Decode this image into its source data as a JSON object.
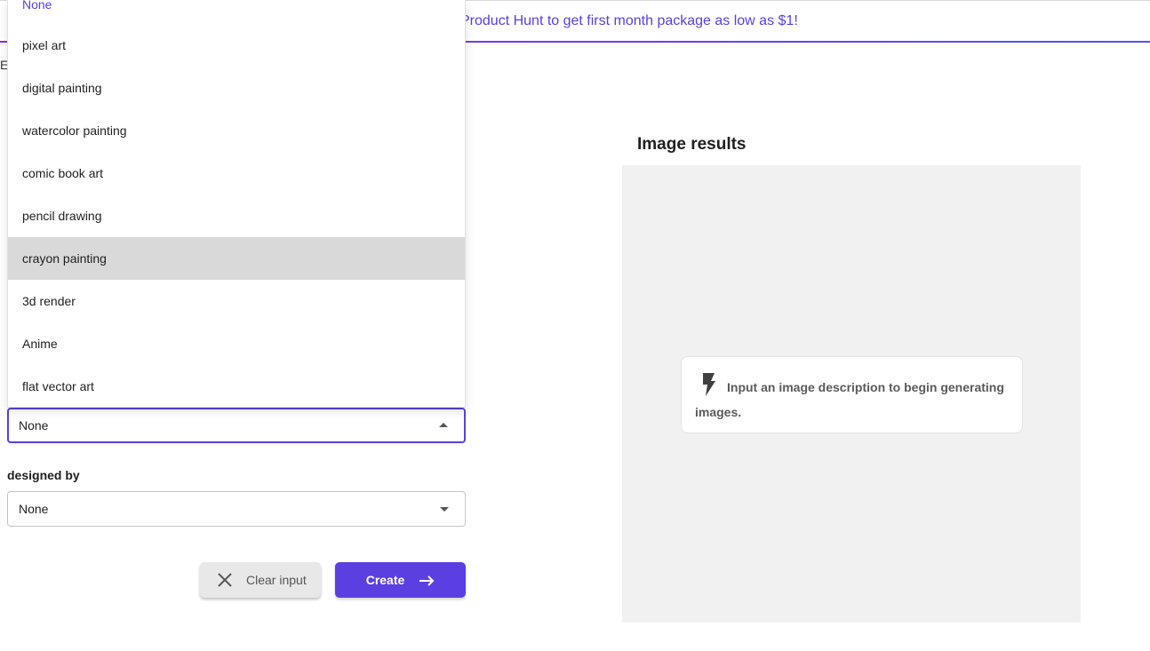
{
  "banner": {
    "text": "Product Hunt to get first month package as low as $1!",
    "clipped_letter": "E"
  },
  "style_dropdown": {
    "options": [
      "None",
      "pixel art",
      "digital painting",
      "watercolor painting",
      "comic book art",
      "pencil drawing",
      "crayon painting",
      "3d render",
      "Anime",
      "flat vector art"
    ],
    "selected": "None",
    "hovered": "crayon painting",
    "value": "None"
  },
  "designed_by": {
    "label": "designed by",
    "value": "None"
  },
  "actions": {
    "clear_label": "Clear input",
    "create_label": "Create"
  },
  "results": {
    "title": "Image results",
    "hint": "Input an image description to begin generating images."
  },
  "colors": {
    "accent": "#5b3fe0",
    "hover": "#d9d9d9",
    "panel": "#f1f1f1"
  },
  "icons": [
    "close-icon",
    "arrow-right-icon",
    "bolt-icon",
    "caret-up-icon",
    "caret-down-icon"
  ]
}
